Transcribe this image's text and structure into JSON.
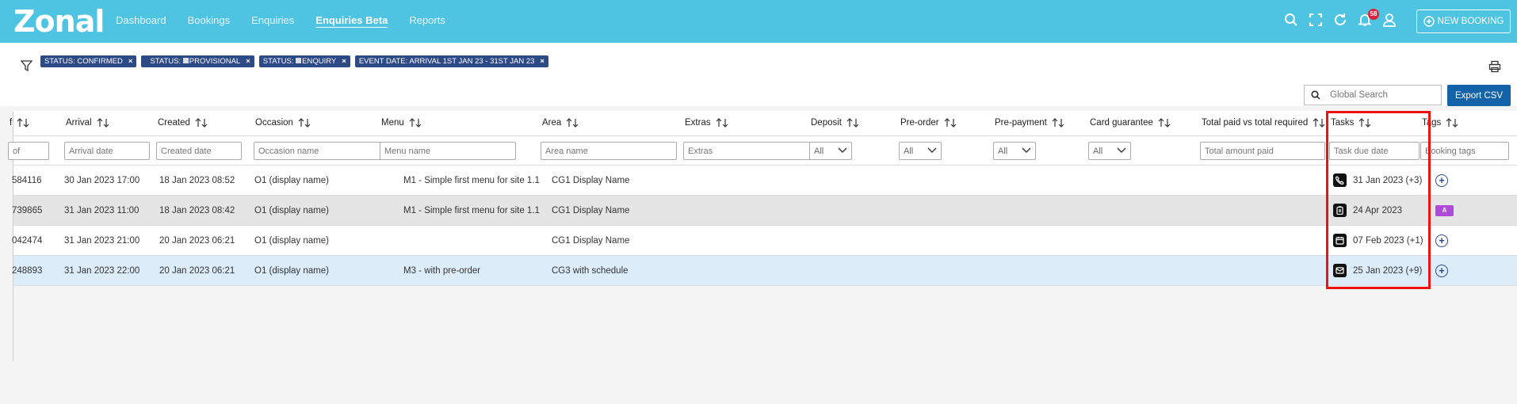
{
  "app": {
    "logo": "Zonal"
  },
  "nav": {
    "items": [
      {
        "label": "Dashboard",
        "active": false
      },
      {
        "label": "Bookings",
        "active": false
      },
      {
        "label": "Enquiries",
        "active": false
      },
      {
        "label": "Enquiries Beta",
        "active": true
      },
      {
        "label": "Reports",
        "active": false
      }
    ]
  },
  "header": {
    "icons": [
      "search-icon",
      "fullscreen-icon",
      "refresh-icon",
      "bell-icon",
      "user-icon"
    ],
    "notification_count": "58",
    "new_booking_label": "NEW BOOKING"
  },
  "filters": {
    "chips": [
      {
        "label": "STATUS: CONFIRMED",
        "swatch": false
      },
      {
        "label": "STATUS: PROVISIONAL",
        "swatch": true
      },
      {
        "label": "STATUS: ENQUIRY",
        "swatch": true
      },
      {
        "label": "EVENT DATE: ARRIVAL 1ST JAN 23 - 31ST JAN 23",
        "swatch": false
      }
    ]
  },
  "search": {
    "placeholder": "Global Search"
  },
  "export_label": "Export CSV",
  "table": {
    "columns": [
      {
        "label": "f",
        "filter": "of",
        "type": "input"
      },
      {
        "label": "Arrival",
        "filter": "Arrival date",
        "type": "input"
      },
      {
        "label": "Created",
        "filter": "Created date",
        "type": "input"
      },
      {
        "label": "Occasion",
        "filter": "Occasion name",
        "type": "input"
      },
      {
        "label": "Menu",
        "filter": "Menu name",
        "type": "input"
      },
      {
        "label": "Area",
        "filter": "Area name",
        "type": "input"
      },
      {
        "label": "Extras",
        "filter": "Extras",
        "type": "input"
      },
      {
        "label": "Deposit",
        "filter": "All",
        "type": "select"
      },
      {
        "label": "Pre-order",
        "filter": "All",
        "type": "select"
      },
      {
        "label": "Pre-payment",
        "filter": "All",
        "type": "select"
      },
      {
        "label": "Card guarantee",
        "filter": "All",
        "type": "select"
      },
      {
        "label": "Total paid vs total required",
        "filter": "Total amount paid",
        "type": "input"
      },
      {
        "label": "Tasks",
        "filter": "Task due date",
        "type": "input"
      },
      {
        "label": "Tags",
        "filter": "Booking tags",
        "type": "input"
      }
    ],
    "rows": [
      {
        "ref": "584116",
        "arrival": "30 Jan 2023 17:00",
        "created": "18 Jan 2023 08:52",
        "occasion": "O1 (display name)",
        "menu": "M1 - Simple first menu for site 1.1",
        "area": "CG1 Display Name",
        "task_icon": "phone-icon",
        "task": "31 Jan 2023 (+3)",
        "tag": "add",
        "bg": "#ffffff"
      },
      {
        "ref": "739865",
        "arrival": "31 Jan 2023 11:00",
        "created": "18 Jan 2023 08:42",
        "occasion": "O1 (display name)",
        "menu": "M1 - Simple first menu for site 1.1",
        "area": "CG1 Display Name",
        "task_icon": "clipboard-icon",
        "task": "24 Apr 2023",
        "tag": "pill",
        "bg": "#e5e5e5"
      },
      {
        "ref": "042474",
        "arrival": "31 Jan 2023 21:00",
        "created": "20 Jan 2023 06:21",
        "occasion": "O1 (display name)",
        "menu": "",
        "area": "CG1 Display Name",
        "task_icon": "calendar-icon",
        "task": "07 Feb 2023 (+1)",
        "tag": "add",
        "bg": "#ffffff"
      },
      {
        "ref": "248893",
        "arrival": "31 Jan 2023 22:00",
        "created": "20 Jan 2023 06:21",
        "occasion": "O1 (display name)",
        "menu": "M3 - with pre-order",
        "area": "CG3 with schedule",
        "task_icon": "mail-icon",
        "task": "25 Jan 2023 (+9)",
        "tag": "add",
        "bg": "#dcecf9"
      }
    ],
    "tag_pill_text": "A"
  },
  "colors": {
    "topbar": "#4ec3e2",
    "chip": "#2c4a86",
    "export": "#1463a8",
    "highlight": "#ee1111"
  }
}
